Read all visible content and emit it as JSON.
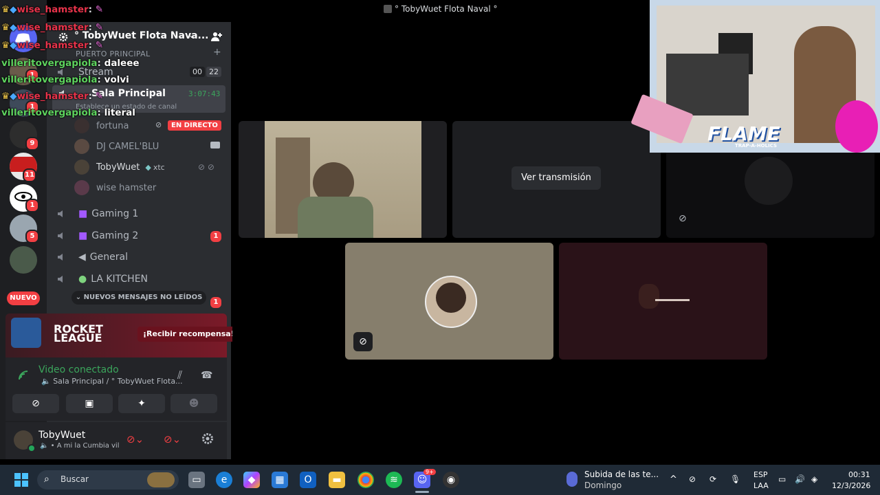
{
  "window": {
    "title": "° TobyWuet Flota Naval °"
  },
  "server": {
    "name": "° TobyWuet Flota Nava...",
    "category": "PUERTO PRINCIPAL",
    "stream_channel": "Stream",
    "stream_counts": [
      "00",
      "22"
    ],
    "main_channel": {
      "name": "Sala Principal",
      "timer": "3:07:43",
      "status": "Establece un estado de canal"
    },
    "users": [
      {
        "name": "fortuna",
        "tag": "EN DIRECTO"
      },
      {
        "name": "DJ CAMEL'BLU"
      },
      {
        "name": "TobyWuet",
        "tag": "xtc"
      },
      {
        "name": "wise hamster"
      }
    ],
    "channels": [
      {
        "name": "Gaming 1",
        "badge": ""
      },
      {
        "name": "Gaming 2",
        "badge": "1"
      },
      {
        "name": "General",
        "badge": ""
      },
      {
        "name": "LA KITCHEN",
        "badge": ""
      }
    ],
    "unread_banner": "NUEVOS MENSAJES NO LEÍDOS",
    "unread_badge": "1"
  },
  "rail": {
    "badges": [
      "1",
      "1",
      "9",
      "11",
      "1",
      "5"
    ],
    "nuevo": "NUEVO"
  },
  "chat": [
    {
      "user": "wise_hamster",
      "msg": "",
      "red": true
    },
    {
      "user": "wise_hamster",
      "msg": "",
      "red": true
    },
    {
      "user": "wise_hamster",
      "msg": "",
      "red": true
    },
    {
      "user": "villeritovergapiola",
      "msg": "daleee",
      "red": false
    },
    {
      "user": "villeritovergapiola",
      "msg": "volvi",
      "red": false
    },
    {
      "user": "wise_hamster",
      "msg": "",
      "red": true
    },
    {
      "user": "villeritovergapiola",
      "msg": "literal",
      "red": false
    }
  ],
  "promo": {
    "logo_line1": "ROCKET",
    "logo_line2": "LEAGUE",
    "button": "¡Recibir recompensa!"
  },
  "voice": {
    "status": "Video conectado",
    "location": "Sala Principal / ° TobyWuet Flota..."
  },
  "userbar": {
    "name": "TobyWuet",
    "status": "A mi la Cumbia vill"
  },
  "stage": {
    "stream_overlay": "Ver transmisión"
  },
  "webcam_overlay": {
    "text": "FLAME",
    "sub": "TRAP-A-HOLICS"
  },
  "taskbar": {
    "search_placeholder": "Buscar",
    "notify_title": "Subida de las te...",
    "notify_sub": "Domingo",
    "lang1": "ESP",
    "lang2": "LAA",
    "time": "00:31",
    "date": "12/3/2026",
    "discord_badge": "9+"
  }
}
